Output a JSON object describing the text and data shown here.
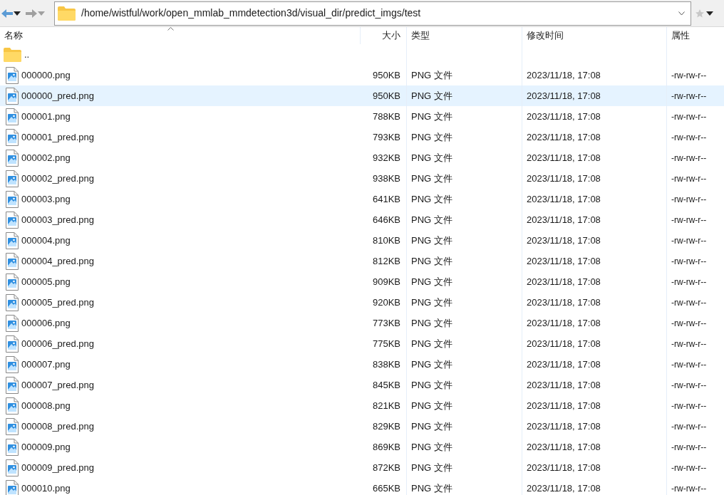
{
  "address_bar": {
    "path": "/home/wistful/work/open_mmlab_mmdetection3d/visual_dir/predict_imgs/test"
  },
  "table": {
    "columns": [
      {
        "label": "名称",
        "sorted": true
      },
      {
        "label": "大小",
        "sorted": false
      },
      {
        "label": "类型",
        "sorted": false
      },
      {
        "label": "修改时间",
        "sorted": false
      },
      {
        "label": "属性",
        "sorted": false
      }
    ],
    "rows": [
      {
        "kind": "folder",
        "name": "..",
        "selected": false
      },
      {
        "kind": "file",
        "name": "000000.png",
        "size": "950KB",
        "type": "PNG 文件",
        "modified": "2023/11/18, 17:08",
        "attributes": "-rw-rw-r--",
        "selected": false
      },
      {
        "kind": "file",
        "name": "000000_pred.png",
        "size": "950KB",
        "type": "PNG 文件",
        "modified": "2023/11/18, 17:08",
        "attributes": "-rw-rw-r--",
        "selected": true
      },
      {
        "kind": "file",
        "name": "000001.png",
        "size": "788KB",
        "type": "PNG 文件",
        "modified": "2023/11/18, 17:08",
        "attributes": "-rw-rw-r--",
        "selected": false
      },
      {
        "kind": "file",
        "name": "000001_pred.png",
        "size": "793KB",
        "type": "PNG 文件",
        "modified": "2023/11/18, 17:08",
        "attributes": "-rw-rw-r--",
        "selected": false
      },
      {
        "kind": "file",
        "name": "000002.png",
        "size": "932KB",
        "type": "PNG 文件",
        "modified": "2023/11/18, 17:08",
        "attributes": "-rw-rw-r--",
        "selected": false
      },
      {
        "kind": "file",
        "name": "000002_pred.png",
        "size": "938KB",
        "type": "PNG 文件",
        "modified": "2023/11/18, 17:08",
        "attributes": "-rw-rw-r--",
        "selected": false
      },
      {
        "kind": "file",
        "name": "000003.png",
        "size": "641KB",
        "type": "PNG 文件",
        "modified": "2023/11/18, 17:08",
        "attributes": "-rw-rw-r--",
        "selected": false
      },
      {
        "kind": "file",
        "name": "000003_pred.png",
        "size": "646KB",
        "type": "PNG 文件",
        "modified": "2023/11/18, 17:08",
        "attributes": "-rw-rw-r--",
        "selected": false
      },
      {
        "kind": "file",
        "name": "000004.png",
        "size": "810KB",
        "type": "PNG 文件",
        "modified": "2023/11/18, 17:08",
        "attributes": "-rw-rw-r--",
        "selected": false
      },
      {
        "kind": "file",
        "name": "000004_pred.png",
        "size": "812KB",
        "type": "PNG 文件",
        "modified": "2023/11/18, 17:08",
        "attributes": "-rw-rw-r--",
        "selected": false
      },
      {
        "kind": "file",
        "name": "000005.png",
        "size": "909KB",
        "type": "PNG 文件",
        "modified": "2023/11/18, 17:08",
        "attributes": "-rw-rw-r--",
        "selected": false
      },
      {
        "kind": "file",
        "name": "000005_pred.png",
        "size": "920KB",
        "type": "PNG 文件",
        "modified": "2023/11/18, 17:08",
        "attributes": "-rw-rw-r--",
        "selected": false
      },
      {
        "kind": "file",
        "name": "000006.png",
        "size": "773KB",
        "type": "PNG 文件",
        "modified": "2023/11/18, 17:08",
        "attributes": "-rw-rw-r--",
        "selected": false
      },
      {
        "kind": "file",
        "name": "000006_pred.png",
        "size": "775KB",
        "type": "PNG 文件",
        "modified": "2023/11/18, 17:08",
        "attributes": "-rw-rw-r--",
        "selected": false
      },
      {
        "kind": "file",
        "name": "000007.png",
        "size": "838KB",
        "type": "PNG 文件",
        "modified": "2023/11/18, 17:08",
        "attributes": "-rw-rw-r--",
        "selected": false
      },
      {
        "kind": "file",
        "name": "000007_pred.png",
        "size": "845KB",
        "type": "PNG 文件",
        "modified": "2023/11/18, 17:08",
        "attributes": "-rw-rw-r--",
        "selected": false
      },
      {
        "kind": "file",
        "name": "000008.png",
        "size": "821KB",
        "type": "PNG 文件",
        "modified": "2023/11/18, 17:08",
        "attributes": "-rw-rw-r--",
        "selected": false
      },
      {
        "kind": "file",
        "name": "000008_pred.png",
        "size": "829KB",
        "type": "PNG 文件",
        "modified": "2023/11/18, 17:08",
        "attributes": "-rw-rw-r--",
        "selected": false
      },
      {
        "kind": "file",
        "name": "000009.png",
        "size": "869KB",
        "type": "PNG 文件",
        "modified": "2023/11/18, 17:08",
        "attributes": "-rw-rw-r--",
        "selected": false
      },
      {
        "kind": "file",
        "name": "000009_pred.png",
        "size": "872KB",
        "type": "PNG 文件",
        "modified": "2023/11/18, 17:08",
        "attributes": "-rw-rw-r--",
        "selected": false
      },
      {
        "kind": "file",
        "name": "000010.png",
        "size": "665KB",
        "type": "PNG 文件",
        "modified": "2023/11/18, 17:08",
        "attributes": "-rw-rw-r--",
        "selected": false
      }
    ]
  }
}
